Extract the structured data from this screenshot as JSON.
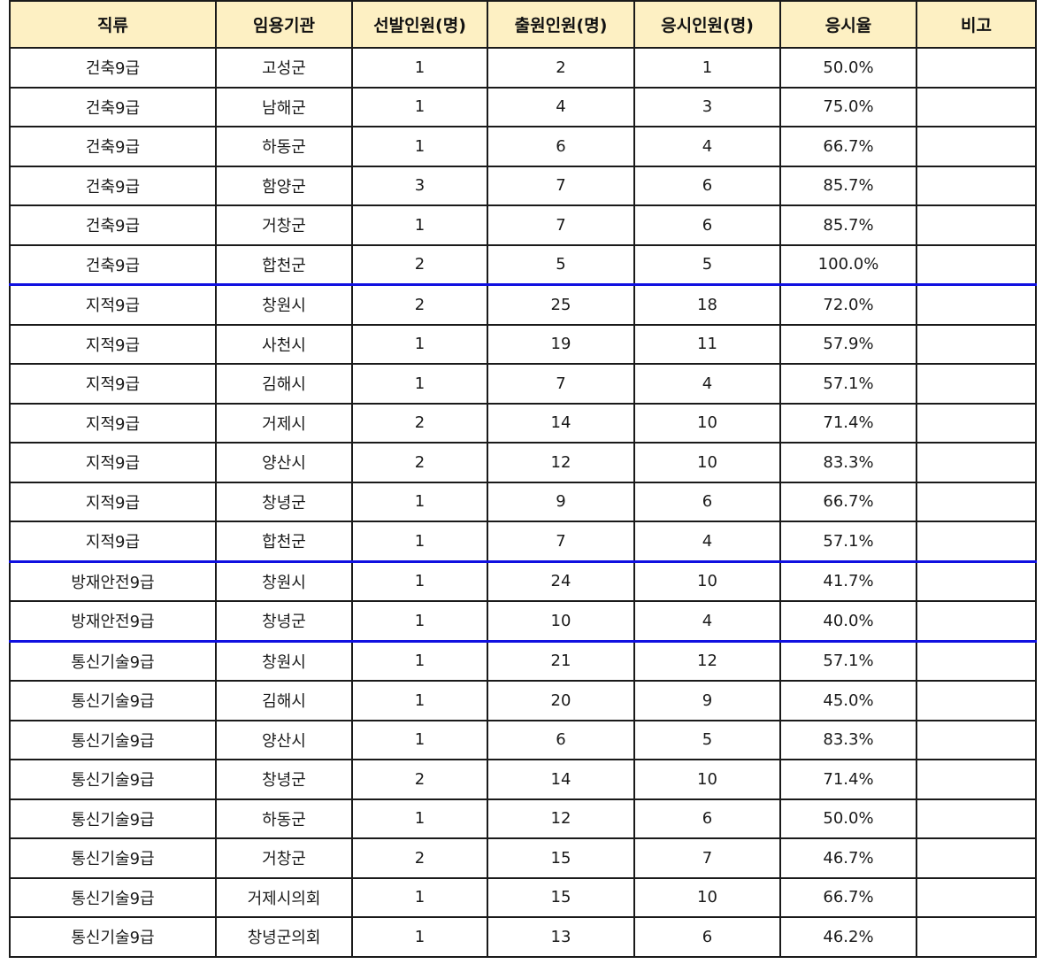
{
  "table": {
    "headers": [
      "직류",
      "임용기관",
      "선발인원(명)",
      "출원인원(명)",
      "응시인원(명)",
      "응시율",
      "비고"
    ],
    "rows": [
      {
        "cells": [
          "건축9급",
          "고성군",
          "1",
          "2",
          "1",
          "50.0%",
          ""
        ],
        "group_start": false
      },
      {
        "cells": [
          "건축9급",
          "남해군",
          "1",
          "4",
          "3",
          "75.0%",
          ""
        ],
        "group_start": false
      },
      {
        "cells": [
          "건축9급",
          "하동군",
          "1",
          "6",
          "4",
          "66.7%",
          ""
        ],
        "group_start": false
      },
      {
        "cells": [
          "건축9급",
          "함양군",
          "3",
          "7",
          "6",
          "85.7%",
          ""
        ],
        "group_start": false
      },
      {
        "cells": [
          "건축9급",
          "거창군",
          "1",
          "7",
          "6",
          "85.7%",
          ""
        ],
        "group_start": false
      },
      {
        "cells": [
          "건축9급",
          "합천군",
          "2",
          "5",
          "5",
          "100.0%",
          ""
        ],
        "group_start": false
      },
      {
        "cells": [
          "지적9급",
          "창원시",
          "2",
          "25",
          "18",
          "72.0%",
          ""
        ],
        "group_start": true
      },
      {
        "cells": [
          "지적9급",
          "사천시",
          "1",
          "19",
          "11",
          "57.9%",
          ""
        ],
        "group_start": false
      },
      {
        "cells": [
          "지적9급",
          "김해시",
          "1",
          "7",
          "4",
          "57.1%",
          ""
        ],
        "group_start": false
      },
      {
        "cells": [
          "지적9급",
          "거제시",
          "2",
          "14",
          "10",
          "71.4%",
          ""
        ],
        "group_start": false
      },
      {
        "cells": [
          "지적9급",
          "양산시",
          "2",
          "12",
          "10",
          "83.3%",
          ""
        ],
        "group_start": false
      },
      {
        "cells": [
          "지적9급",
          "창녕군",
          "1",
          "9",
          "6",
          "66.7%",
          ""
        ],
        "group_start": false
      },
      {
        "cells": [
          "지적9급",
          "합천군",
          "1",
          "7",
          "4",
          "57.1%",
          ""
        ],
        "group_start": false
      },
      {
        "cells": [
          "방재안전9급",
          "창원시",
          "1",
          "24",
          "10",
          "41.7%",
          ""
        ],
        "group_start": true
      },
      {
        "cells": [
          "방재안전9급",
          "창녕군",
          "1",
          "10",
          "4",
          "40.0%",
          ""
        ],
        "group_start": false
      },
      {
        "cells": [
          "통신기술9급",
          "창원시",
          "1",
          "21",
          "12",
          "57.1%",
          ""
        ],
        "group_start": true
      },
      {
        "cells": [
          "통신기술9급",
          "김해시",
          "1",
          "20",
          "9",
          "45.0%",
          ""
        ],
        "group_start": false
      },
      {
        "cells": [
          "통신기술9급",
          "양산시",
          "1",
          "6",
          "5",
          "83.3%",
          ""
        ],
        "group_start": false
      },
      {
        "cells": [
          "통신기술9급",
          "창녕군",
          "2",
          "14",
          "10",
          "71.4%",
          ""
        ],
        "group_start": false
      },
      {
        "cells": [
          "통신기술9급",
          "하동군",
          "1",
          "12",
          "6",
          "50.0%",
          ""
        ],
        "group_start": false
      },
      {
        "cells": [
          "통신기술9급",
          "거창군",
          "2",
          "15",
          "7",
          "46.7%",
          ""
        ],
        "group_start": false
      },
      {
        "cells": [
          "통신기술9급",
          "거제시의회",
          "1",
          "15",
          "10",
          "66.7%",
          ""
        ],
        "group_start": false
      },
      {
        "cells": [
          "통신기술9급",
          "창녕군의회",
          "1",
          "13",
          "6",
          "46.2%",
          ""
        ],
        "group_start": false
      }
    ]
  },
  "colors": {
    "header_bg": "#fdf0c3",
    "grid": "#1a1a1a",
    "group_divider": "#1010e0"
  }
}
